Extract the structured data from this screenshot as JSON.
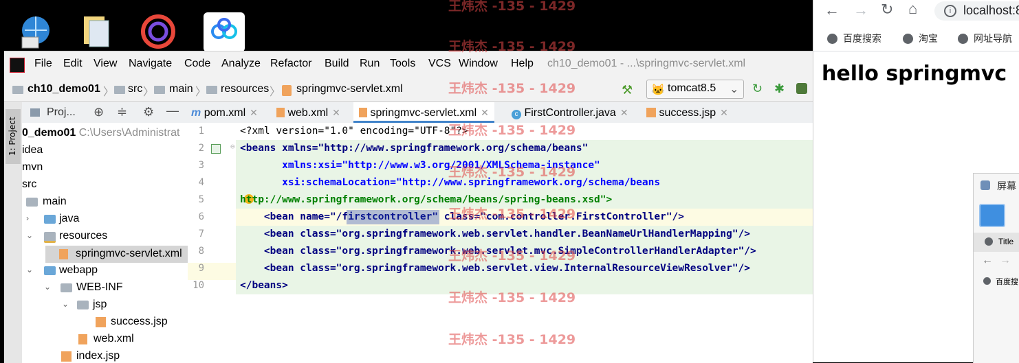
{
  "desktop": {
    "icons": [
      "network-icon",
      "documents-icon",
      "app-logo-icon",
      "cloud-app-icon"
    ]
  },
  "watermarks": [
    "王炜杰 -135 - 1429"
  ],
  "ide": {
    "menu": [
      "File",
      "Edit",
      "View",
      "Navigate",
      "Code",
      "Analyze",
      "Refactor",
      "Build",
      "Run",
      "Tools",
      "VCS",
      "Window",
      "Help"
    ],
    "window_title": "ch10_demo01 - ...\\springmvc-servlet.xml",
    "breadcrumb": [
      "ch10_demo01",
      "src",
      "main",
      "resources",
      "springmvc-servlet.xml"
    ],
    "run_config": "tomcat8.5",
    "side_tab": "1: Project",
    "project_dropdown": "Proj...",
    "tabs": [
      "pom.xml",
      "web.xml",
      "springmvc-servlet.xml",
      "FirstController.java",
      "success.jsp"
    ],
    "tree": [
      {
        "label": "0_demo01",
        "extra": "C:\\Users\\Administrat"
      },
      {
        "label": "idea",
        "extra": ""
      },
      {
        "label": "mvn",
        "extra": ""
      },
      {
        "label": "src",
        "extra": ""
      },
      {
        "label": "main",
        "extra": ""
      },
      {
        "label": "java",
        "extra": ""
      },
      {
        "label": "resources",
        "extra": ""
      },
      {
        "label": "springmvc-servlet.xml",
        "extra": ""
      },
      {
        "label": "webapp",
        "extra": ""
      },
      {
        "label": "WEB-INF",
        "extra": ""
      },
      {
        "label": "jsp",
        "extra": ""
      },
      {
        "label": "success.jsp",
        "extra": ""
      },
      {
        "label": "web.xml",
        "extra": ""
      },
      {
        "label": "index.jsp",
        "extra": ""
      }
    ],
    "line_numbers": [
      "1",
      "2",
      "3",
      "4",
      "5",
      "6",
      "7",
      "8",
      "9",
      "10"
    ],
    "code": [
      "<?xml version=\"1.0\" encoding=\"UTF-8\"?>",
      "<beans xmlns=\"http://www.springframework.org/schema/beans\"",
      "       xmlns:xsi=\"http://www.w3.org/2001/XMLSchema-instance\"",
      "       xsi:schemaLocation=\"http://www.springframework.org/schema/beans",
      "http://www.springframework.org/schema/beans/spring-beans.xsd\">",
      "    <bean name=\"/firstcontroller\" class=\"com.controller.FirstController\"/>",
      "    <bean class=\"org.springframework.web.servlet.handler.BeanNameUrlHandlerMapping\"/>",
      "    <bean class=\"org.springframework.web.servlet.mvc.SimpleControllerHandlerAdapter\"/>",
      "    <bean class=\"org.springframework.web.servlet.view.InternalResourceViewResolver\"/>",
      "</beans>"
    ]
  },
  "browser": {
    "url": "localhost:8",
    "bookmarks": [
      "百度搜索",
      "淘宝",
      "网址导航"
    ],
    "body_text": "hello springmvc",
    "subwindow": {
      "title": "屏幕",
      "tab": "Title",
      "bookmark": "百度搜"
    }
  }
}
